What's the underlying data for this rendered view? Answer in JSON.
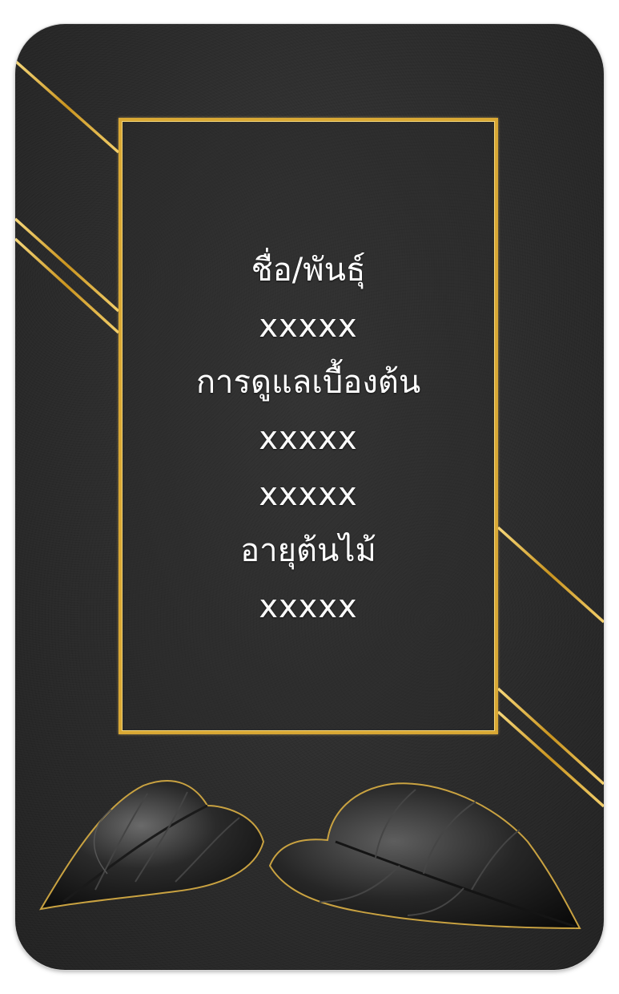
{
  "card": {
    "accent_color": "#d9a834",
    "background_color": "#2e2e2e"
  },
  "lines": {
    "name_label": "ชื่อ/พันธุ์",
    "name_value": "xxxxx",
    "care_label": "การดูแลเบื้องต้น",
    "care_value_1": "xxxxx",
    "care_value_2": "xxxxx",
    "age_label": "อายุต้นไม้",
    "age_value": "xxxxx"
  },
  "decorations": {
    "stripes": "gold-diagonal-stripes",
    "leaves": "black-leaves-with-gold-edge"
  }
}
